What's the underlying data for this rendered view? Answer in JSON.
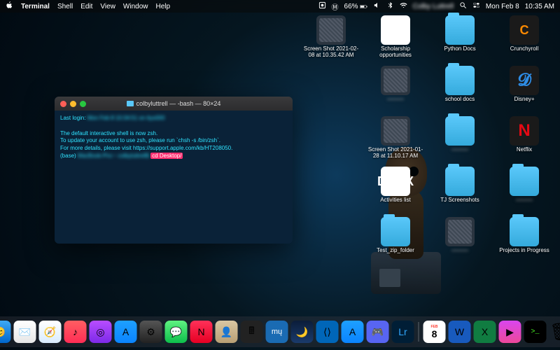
{
  "menubar": {
    "app_name": "Terminal",
    "menus": [
      "Shell",
      "Edit",
      "View",
      "Window",
      "Help"
    ],
    "battery_pct": "66%",
    "date": "Mon Feb 8",
    "time": "10:35 AM"
  },
  "terminal": {
    "title": "colbyluttrell — -bash — 80×24",
    "last_login_prefix": "Last login:",
    "line1": "The default interactive shell is now zsh.",
    "line2": "To update your account to use zsh, please run `chsh -s /bin/zsh`.",
    "line3": "For more details, please visit https://support.apple.com/kb/HT208050.",
    "prompt_prefix": "(base)",
    "command": "cd Desktop/"
  },
  "desktop_items": [
    {
      "kind": "img",
      "label": "Screen Shot 2021-02-08 at 10.35.42 AM"
    },
    {
      "kind": "doc",
      "label": "Scholarship opportunities"
    },
    {
      "kind": "folder",
      "label": "Python Docs"
    },
    {
      "kind": "app",
      "style": "orange",
      "glyph": "C",
      "label": "Crunchyroll"
    },
    {
      "kind": "blank"
    },
    {
      "kind": "img",
      "label": ""
    },
    {
      "kind": "folder",
      "label": "school docs"
    },
    {
      "kind": "app",
      "style": "blue",
      "glyph": "𝓓",
      "label": "Disney+"
    },
    {
      "kind": "blank"
    },
    {
      "kind": "img",
      "label": "Screen Shot 2021-01-28 at 11.10.17 AM"
    },
    {
      "kind": "folder",
      "label": ""
    },
    {
      "kind": "app",
      "style": "red",
      "glyph": "N",
      "label": "Netflix"
    },
    {
      "kind": "blank"
    },
    {
      "kind": "doc",
      "glyph": "DOCX",
      "label": "Activities list"
    },
    {
      "kind": "folder",
      "label": "TJ Screenshots"
    },
    {
      "kind": "folder",
      "label": ""
    },
    {
      "kind": "blank"
    },
    {
      "kind": "folder",
      "label": "Test_zip_folder"
    },
    {
      "kind": "img",
      "label": ""
    },
    {
      "kind": "folder",
      "label": "Projects in Progress"
    }
  ],
  "dock": [
    {
      "name": "finder",
      "bg": "linear-gradient(#3fa9f5,#0066cc)",
      "glyph": "😊"
    },
    {
      "name": "mail",
      "bg": "linear-gradient(#fff,#e6e6e6)",
      "glyph": "✉️"
    },
    {
      "name": "safari",
      "bg": "linear-gradient(#fff,#d9ecff)",
      "glyph": "🧭"
    },
    {
      "name": "music",
      "bg": "linear-gradient(#ff5e62,#ff2d55)",
      "glyph": "♪"
    },
    {
      "name": "podcasts",
      "bg": "linear-gradient(#b84dff,#7d2ae8)",
      "glyph": "◎"
    },
    {
      "name": "appstore",
      "bg": "linear-gradient(#1ea0ff,#0a84ff)",
      "glyph": "A"
    },
    {
      "name": "settings",
      "bg": "linear-gradient(#555,#222)",
      "glyph": "⚙"
    },
    {
      "name": "messages",
      "bg": "linear-gradient(#5ff281,#0dbf4b)",
      "glyph": "💬"
    },
    {
      "name": "news",
      "bg": "linear-gradient(#ff3159,#e60023)",
      "glyph": "N"
    },
    {
      "name": "contacts",
      "bg": "linear-gradient(#d9c7a3,#b89f74)",
      "glyph": "👤"
    },
    {
      "name": "calculator",
      "bg": "#222",
      "glyph": "🖩"
    },
    {
      "name": "musescore",
      "bg": "#1a6bb3",
      "glyph": "mų"
    },
    {
      "name": "stellarium",
      "bg": "linear-gradient(#0b1d3a,#1a3a6b)",
      "glyph": "🌙"
    },
    {
      "name": "vscode",
      "bg": "#0066b8",
      "glyph": "⟨⟩"
    },
    {
      "name": "appstore2",
      "bg": "linear-gradient(#1ea0ff,#0a84ff)",
      "glyph": "A"
    },
    {
      "name": "discord",
      "bg": "#5865f2",
      "glyph": "🎮"
    },
    {
      "name": "lightroom",
      "bg": "#001e36",
      "glyph": "Lr"
    },
    {
      "name": "sep"
    },
    {
      "name": "calendar",
      "bg": "#fff",
      "glyph": "8"
    },
    {
      "name": "word",
      "bg": "#185abd",
      "glyph": "W"
    },
    {
      "name": "excel",
      "bg": "#107c41",
      "glyph": "X"
    },
    {
      "name": "shortcuts",
      "bg": "linear-gradient(#d946ef,#ec4899)",
      "glyph": "▶"
    },
    {
      "name": "terminal",
      "bg": "#000",
      "glyph": ">_"
    },
    {
      "name": "trash",
      "bg": "transparent",
      "glyph": "🗑"
    }
  ]
}
